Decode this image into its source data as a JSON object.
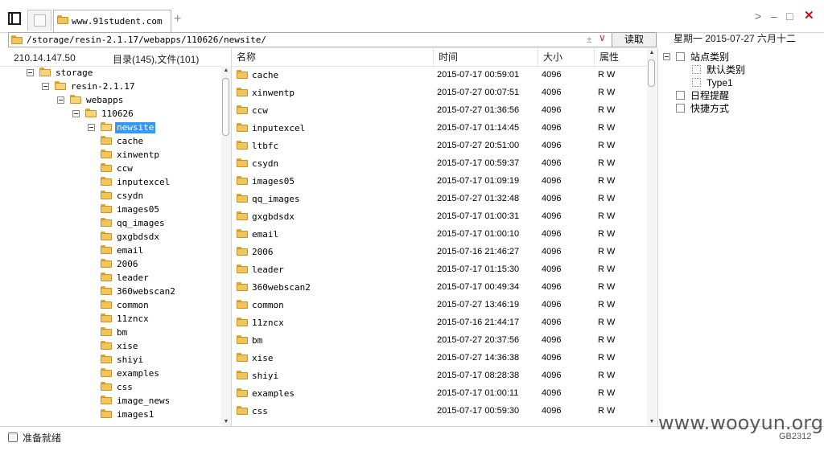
{
  "tabs": [
    {
      "label": "www.91student.com",
      "active": true
    }
  ],
  "new_tab_symbol": "+",
  "window_controls": {
    "forward": ">",
    "minimize": "–",
    "maximize": "□",
    "close": "✕"
  },
  "pathbar": {
    "path": "/storage/resin-2.1.17/webapps/110626/newsite/",
    "plus_symbol": "±",
    "dropdown_symbol": "∨",
    "read_button": "读取"
  },
  "date_text": "星期一 2015-07-27 六月十二",
  "left_pane": {
    "ip": "210.14.147.50",
    "counts": "目录(145),文件(101)",
    "tree": [
      {
        "label": "storage",
        "depth": 0,
        "expanded": true
      },
      {
        "label": "resin-2.1.17",
        "depth": 1,
        "expanded": true
      },
      {
        "label": "webapps",
        "depth": 2,
        "expanded": true
      },
      {
        "label": "110626",
        "depth": 3,
        "expanded": true
      },
      {
        "label": "newsite",
        "depth": 4,
        "expanded": true,
        "selected": true
      }
    ],
    "children": [
      "cache",
      "xinwentp",
      "ccw",
      "inputexcel",
      "csydn",
      "images05",
      "qq_images",
      "gxgbdsdx",
      "email",
      "2006",
      "leader",
      "360webscan2",
      "common",
      "11zncx",
      "bm",
      "xise",
      "shiyi",
      "examples",
      "css",
      "image_news",
      "images1"
    ]
  },
  "file_list": {
    "columns": [
      "名称",
      "时间",
      "大小",
      "属性"
    ],
    "rows": [
      {
        "name": "cache",
        "time": "2015-07-17 00:59:01",
        "size": "4096",
        "attr": "R W"
      },
      {
        "name": "xinwentp",
        "time": "2015-07-27 00:07:51",
        "size": "4096",
        "attr": "R W"
      },
      {
        "name": "ccw",
        "time": "2015-07-27 01:36:56",
        "size": "4096",
        "attr": "R W"
      },
      {
        "name": "inputexcel",
        "time": "2015-07-17 01:14:45",
        "size": "4096",
        "attr": "R W"
      },
      {
        "name": "ltbfc",
        "time": "2015-07-27 20:51:00",
        "size": "4096",
        "attr": "R W"
      },
      {
        "name": "csydn",
        "time": "2015-07-17 00:59:37",
        "size": "4096",
        "attr": "R W"
      },
      {
        "name": "images05",
        "time": "2015-07-17 01:09:19",
        "size": "4096",
        "attr": "R W"
      },
      {
        "name": "qq_images",
        "time": "2015-07-27 01:32:48",
        "size": "4096",
        "attr": "R W"
      },
      {
        "name": "gxgbdsdx",
        "time": "2015-07-17 01:00:31",
        "size": "4096",
        "attr": "R W"
      },
      {
        "name": "email",
        "time": "2015-07-17 01:00:10",
        "size": "4096",
        "attr": "R W"
      },
      {
        "name": "2006",
        "time": "2015-07-16 21:46:27",
        "size": "4096",
        "attr": "R W"
      },
      {
        "name": "leader",
        "time": "2015-07-17 01:15:30",
        "size": "4096",
        "attr": "R W"
      },
      {
        "name": "360webscan2",
        "time": "2015-07-17 00:49:34",
        "size": "4096",
        "attr": "R W"
      },
      {
        "name": "common",
        "time": "2015-07-27 13:46:19",
        "size": "4096",
        "attr": "R W"
      },
      {
        "name": "11zncx",
        "time": "2015-07-16 21:44:17",
        "size": "4096",
        "attr": "R W"
      },
      {
        "name": "bm",
        "time": "2015-07-27 20:37:56",
        "size": "4096",
        "attr": "R W"
      },
      {
        "name": "xise",
        "time": "2015-07-27 14:36:38",
        "size": "4096",
        "attr": "R W"
      },
      {
        "name": "shiyi",
        "time": "2015-07-17 08:28:38",
        "size": "4096",
        "attr": "R W"
      },
      {
        "name": "examples",
        "time": "2015-07-17 01:00:11",
        "size": "4096",
        "attr": "R W"
      },
      {
        "name": "css",
        "time": "2015-07-17 00:59:30",
        "size": "4096",
        "attr": "R W"
      }
    ]
  },
  "right_pane": {
    "items": [
      {
        "label": "站点类别",
        "kind": "root"
      },
      {
        "label": "默认类别",
        "kind": "sub"
      },
      {
        "label": "Type1",
        "kind": "sub"
      },
      {
        "label": "日程提醒",
        "kind": "root"
      },
      {
        "label": "快捷方式",
        "kind": "root"
      }
    ]
  },
  "status": {
    "text": "准备就绪",
    "encoding": "GB2312"
  },
  "watermark": "www.wooyun.org"
}
